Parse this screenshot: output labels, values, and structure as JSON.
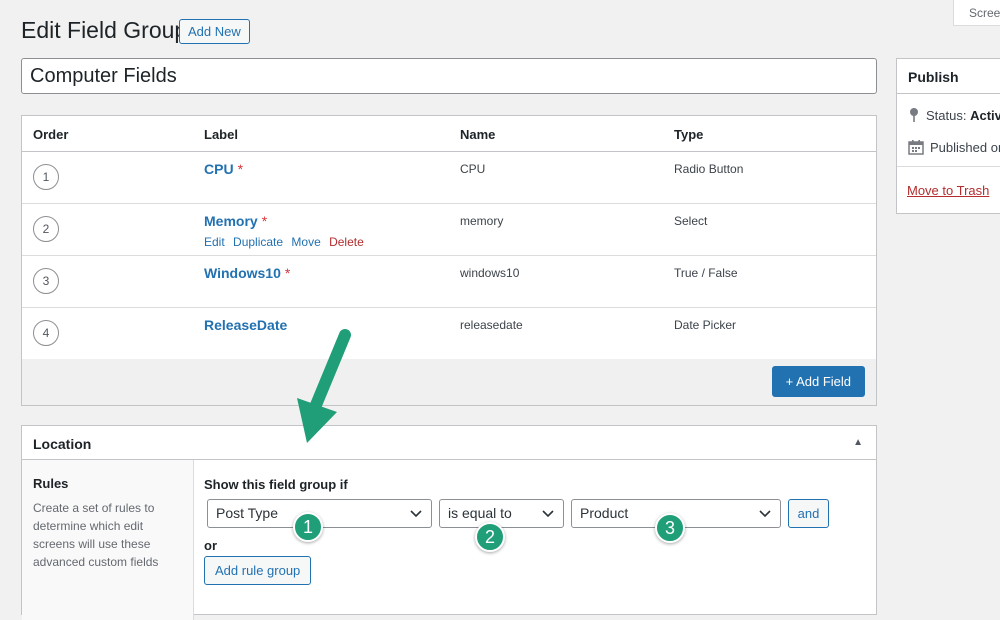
{
  "screen_options": "Screen Options",
  "header": {
    "title": "Edit Field Group",
    "add_new": "Add New"
  },
  "title_field": {
    "value": "Computer Fields"
  },
  "fields_table": {
    "columns": [
      "Order",
      "Label",
      "Name",
      "Type"
    ],
    "rows": [
      {
        "order": "1",
        "label": "CPU",
        "required": "*",
        "name": "CPU",
        "type": "Radio Button"
      },
      {
        "order": "2",
        "label": "Memory",
        "required": "*",
        "name": "memory",
        "type": "Select",
        "actions": [
          "Edit",
          "Duplicate",
          "Move",
          "Delete"
        ]
      },
      {
        "order": "3",
        "label": "Windows10",
        "required": "*",
        "name": "windows10",
        "type": "True / False"
      },
      {
        "order": "4",
        "label": "ReleaseDate",
        "required": "",
        "name": "releasedate",
        "type": "Date Picker"
      }
    ],
    "add_field": "+ Add Field"
  },
  "location": {
    "title": "Location",
    "rules_title": "Rules",
    "rules_desc": "Create a set of rules to determine which edit screens will use these advanced custom fields",
    "show_if": "Show this field group if",
    "param": "Post Type",
    "operator": "is equal to",
    "value": "Product",
    "and_label": "and",
    "or_label": "or",
    "add_rule_group": "Add rule group"
  },
  "publish": {
    "title": "Publish",
    "status_label": "Status:",
    "status_value": "Active",
    "published_on": "Published on:",
    "move_to_trash": "Move to Trash"
  },
  "annotations": {
    "badges": [
      "1",
      "2",
      "3"
    ],
    "accent_color": "#1f9e78"
  },
  "colors": {
    "link": "#2271b1",
    "primary_button": "#2271b1",
    "danger": "#b32d2e"
  }
}
